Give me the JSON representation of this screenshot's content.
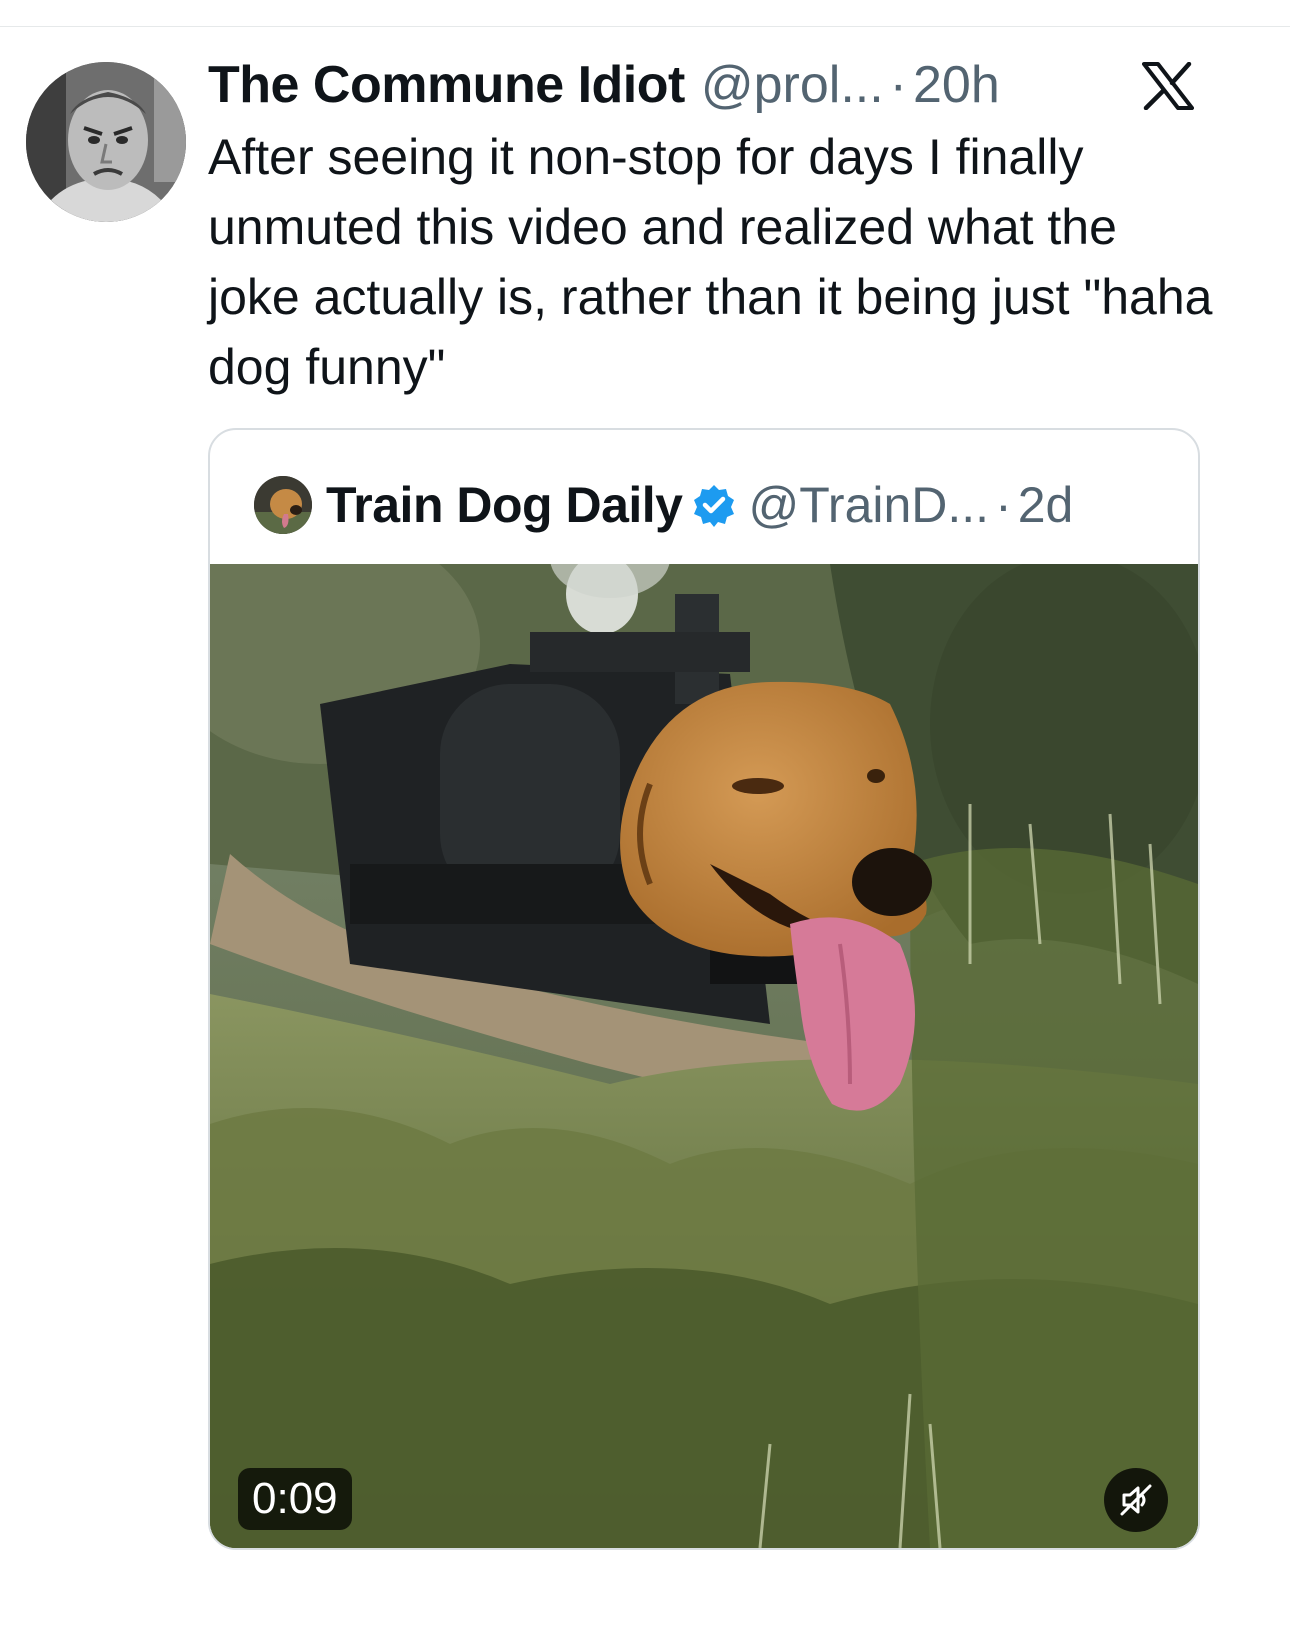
{
  "tweet": {
    "author": {
      "display_name": "The Commune Idiot",
      "handle": "@prol...",
      "avatar_icon": "grayscale-portrait-avatar"
    },
    "separator": "·",
    "time": "20h",
    "platform_icon": "x-logo-icon",
    "text": "After seeing it non-stop for days I finally unmuted this video and realized what the joke actually is, rather than it being just \"haha dog funny\""
  },
  "quoted_tweet": {
    "author": {
      "display_name": "Train Dog Daily",
      "handle": "@TrainD...",
      "verified": true,
      "avatar_icon": "dog-avatar"
    },
    "separator": "·",
    "time": "2d",
    "media": {
      "type": "video",
      "description_icon": "train-with-dog-head-video",
      "duration": "0:09",
      "muted": true,
      "mute_icon": "speaker-muted-icon"
    }
  },
  "colors": {
    "text_primary": "#0f1419",
    "text_secondary": "#536471",
    "verified_blue": "#1d9bf0",
    "border": "#d8dde1"
  }
}
